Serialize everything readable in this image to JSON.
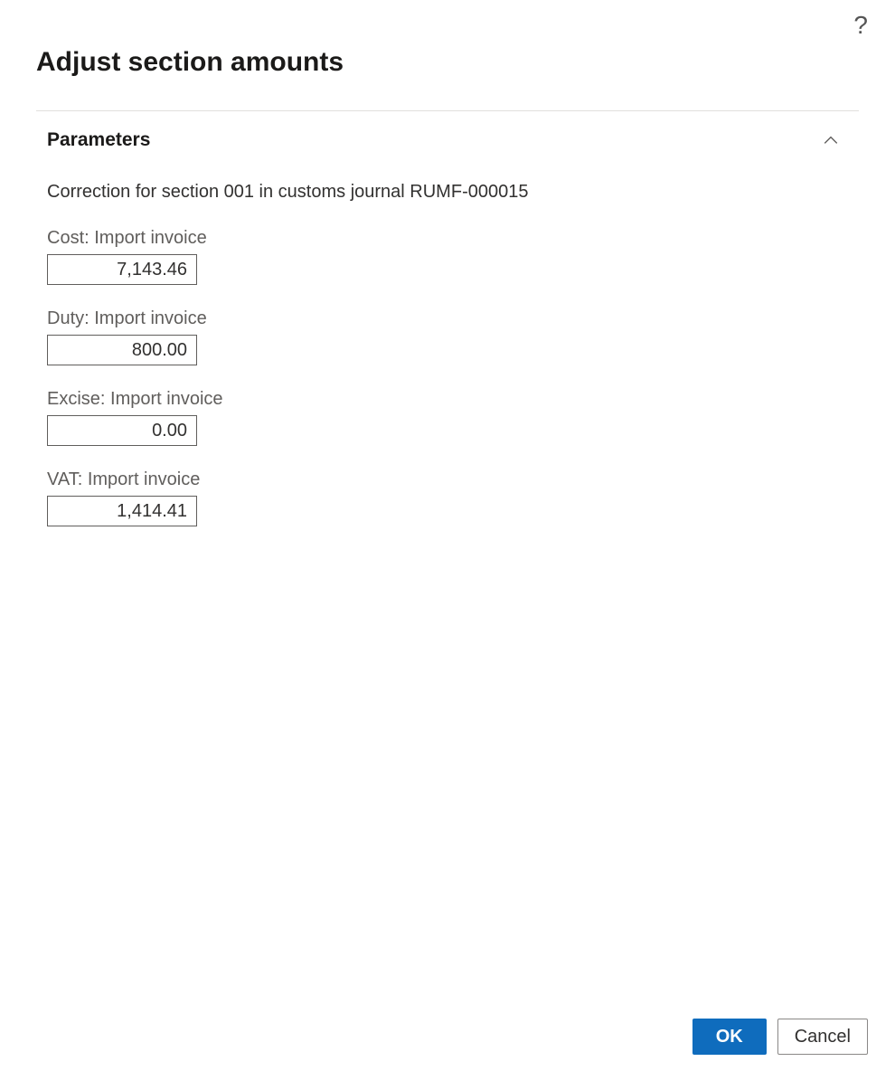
{
  "header": {
    "title": "Adjust section amounts"
  },
  "section": {
    "title": "Parameters",
    "description": "Correction for section 001 in customs journal RUMF-000015",
    "fields": {
      "cost": {
        "label": "Cost: Import invoice",
        "value": "7,143.46"
      },
      "duty": {
        "label": "Duty: Import invoice",
        "value": "800.00"
      },
      "excise": {
        "label": "Excise: Import invoice",
        "value": "0.00"
      },
      "vat": {
        "label": "VAT: Import invoice",
        "value": "1,414.41"
      }
    }
  },
  "buttons": {
    "ok": "OK",
    "cancel": "Cancel"
  }
}
